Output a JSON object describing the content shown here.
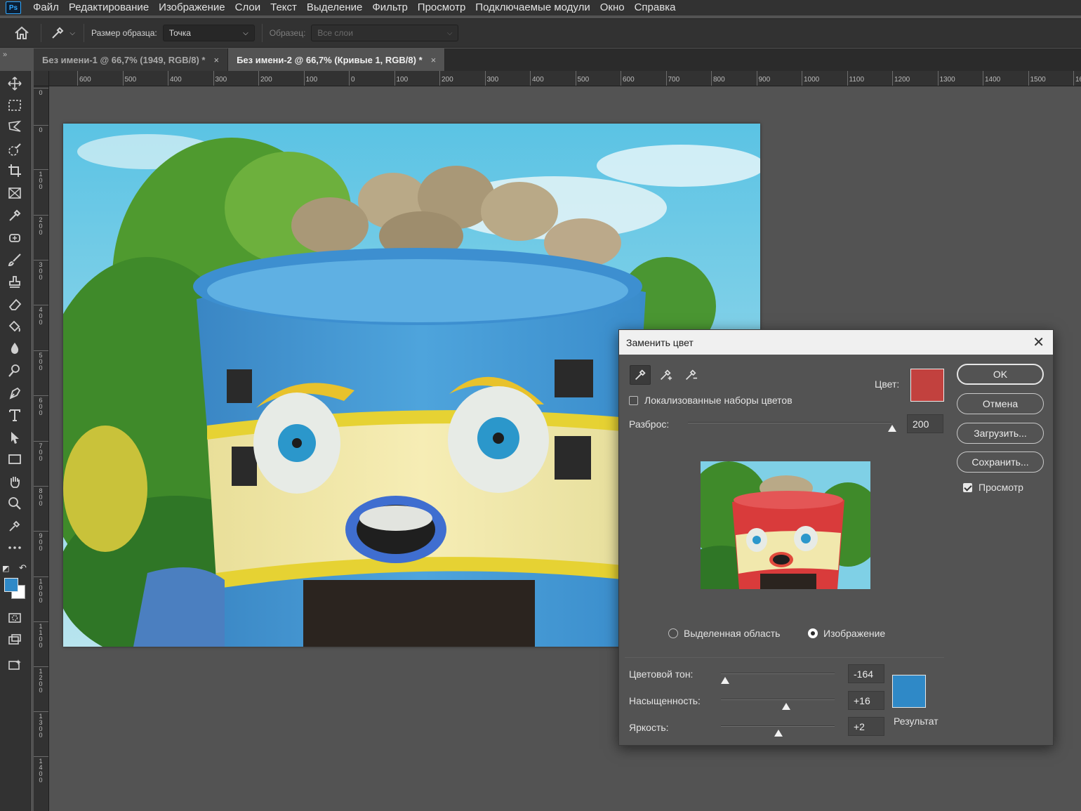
{
  "menubar": {
    "logo": "Ps",
    "items": [
      "Файл",
      "Редактирование",
      "Изображение",
      "Слои",
      "Текст",
      "Выделение",
      "Фильтр",
      "Просмотр",
      "Подключаемые модули",
      "Окно",
      "Справка"
    ]
  },
  "options": {
    "sample_size_label": "Размер образца:",
    "sample_size_value": "Точка",
    "sample_label": "Образец:",
    "sample_value": "Все слои"
  },
  "panel_toggle": "»",
  "tabs": [
    {
      "label": "Без имени-1 @ 66,7% (1949, RGB/8) *",
      "close": "×",
      "active": false
    },
    {
      "label": "Без имени-2 @ 66,7% (Кривые 1, RGB/8) *",
      "close": "×",
      "active": true
    }
  ],
  "ruler": {
    "top_labels": [
      "600",
      "500",
      "400",
      "300",
      "200",
      "100",
      "0",
      "100",
      "200",
      "300",
      "400",
      "500",
      "600",
      "700",
      "800",
      "900",
      "1000",
      "1100",
      "1200",
      "1300",
      "1400",
      "1500",
      "16"
    ],
    "left_labels": [
      "0",
      "0",
      "1 0 0",
      "2 0 0",
      "3 0 0",
      "4 0 0",
      "5 0 0",
      "6 0 0",
      "7 0 0",
      "8 0 0",
      "9 0 0",
      "1 0 0 0",
      "1 1 0 0",
      "1 2 0 0",
      "1 3 0 0",
      "1 4 0 0"
    ]
  },
  "tools": [
    "move-icon",
    "marquee-icon",
    "lasso-icon",
    "quick-select-icon",
    "crop-icon",
    "frame-icon",
    "eyedropper-icon",
    "healing-icon",
    "brush-icon",
    "stamp-icon",
    "eraser-icon",
    "paint-bucket-icon",
    "blur-icon",
    "dodge-icon",
    "pen-icon",
    "type-icon",
    "path-select-icon",
    "rectangle-icon",
    "hand-icon",
    "zoom-icon",
    "edit-toolbar-icon",
    "more-icon"
  ],
  "colors": {
    "foreground": "#2f89c7",
    "background": "#ffffff",
    "selected_color": "#c2413e",
    "result_color": "#2f89c7"
  },
  "dialog": {
    "title": "Заменить цвет",
    "close": "✕",
    "localized_label": "Локализованные наборы цветов",
    "localized_checked": false,
    "color_label": "Цвет:",
    "fuzziness_label": "Разброс:",
    "fuzziness_value": "200",
    "fuzziness_level": 1.0,
    "radio_selection": "Выделенная область",
    "radio_image": "Изображение",
    "hue_label": "Цветовой тон:",
    "hue_value": "-164",
    "saturation_label": "Насыщенность:",
    "saturation_value": "+16",
    "lightness_label": "Яркость:",
    "lightness_value": "+2",
    "result_label": "Результат",
    "buttons": {
      "ok": "OK",
      "cancel": "Отмена",
      "load": "Загрузить...",
      "save": "Сохранить..."
    },
    "preview_label": "Просмотр",
    "preview_checked": true
  }
}
